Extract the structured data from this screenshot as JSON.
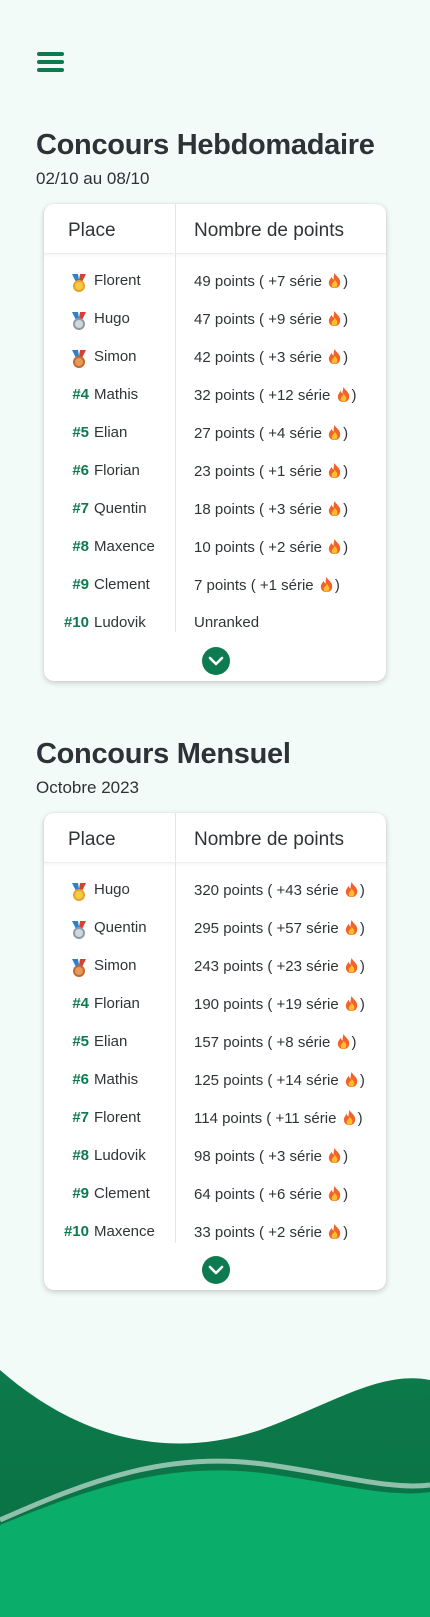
{
  "nav": {
    "menu_icon": "hamburger-menu-icon"
  },
  "colors": {
    "accent": "#0e7a4f",
    "background": "#f3fbf8",
    "wave_dark": "#0a7a48",
    "wave_light": "#0aa868"
  },
  "weekly": {
    "title": "Concours Hebdomadaire",
    "subtitle": "02/10 au 08/10",
    "header_place": "Place",
    "header_points": "Nombre de points",
    "rows": [
      {
        "rank": "",
        "medal": "gold",
        "name": "Florent",
        "points": "49 points ( +7 série",
        "suffix": ")",
        "fire": true
      },
      {
        "rank": "",
        "medal": "silver",
        "name": "Hugo",
        "points": "47 points ( +9 série",
        "suffix": ")",
        "fire": true
      },
      {
        "rank": "",
        "medal": "bronze",
        "name": "Simon",
        "points": "42 points ( +3 série",
        "suffix": ")",
        "fire": true
      },
      {
        "rank": "#4",
        "name": "Mathis",
        "points": "32 points ( +12 série",
        "suffix": ")",
        "fire": true
      },
      {
        "rank": "#5",
        "name": "Elian",
        "points": "27 points ( +4 série",
        "suffix": ")",
        "fire": true
      },
      {
        "rank": "#6",
        "name": "Florian",
        "points": "23 points ( +1 série",
        "suffix": ")",
        "fire": true
      },
      {
        "rank": "#7",
        "name": "Quentin",
        "points": "18 points ( +3 série",
        "suffix": ")",
        "fire": true
      },
      {
        "rank": "#8",
        "name": "Maxence",
        "points": "10 points ( +2 série",
        "suffix": ")",
        "fire": true
      },
      {
        "rank": "#9",
        "name": "Clement",
        "points": "7 points ( +1 série",
        "suffix": ")",
        "fire": true
      },
      {
        "rank": "#10",
        "name": "Ludovik",
        "points": "Unranked",
        "suffix": "",
        "fire": false
      }
    ],
    "expand_icon": "chevron-down-icon"
  },
  "monthly": {
    "title": "Concours Mensuel",
    "subtitle": "Octobre 2023",
    "header_place": "Place",
    "header_points": "Nombre de points",
    "rows": [
      {
        "rank": "",
        "medal": "gold",
        "name": "Hugo",
        "points": "320 points ( +43 série",
        "suffix": ")",
        "fire": true
      },
      {
        "rank": "",
        "medal": "silver",
        "name": "Quentin",
        "points": "295 points ( +57 série",
        "suffix": ")",
        "fire": true
      },
      {
        "rank": "",
        "medal": "bronze",
        "name": "Simon",
        "points": "243 points ( +23 série",
        "suffix": ")",
        "fire": true
      },
      {
        "rank": "#4",
        "name": "Florian",
        "points": "190 points ( +19 série",
        "suffix": ")",
        "fire": true
      },
      {
        "rank": "#5",
        "name": "Elian",
        "points": "157 points ( +8 série",
        "suffix": ")",
        "fire": true
      },
      {
        "rank": "#6",
        "name": "Mathis",
        "points": "125 points ( +14 série",
        "suffix": ")",
        "fire": true
      },
      {
        "rank": "#7",
        "name": "Florent",
        "points": "114 points ( +11 série",
        "suffix": ")",
        "fire": true
      },
      {
        "rank": "#8",
        "name": "Ludovik",
        "points": "98 points ( +3 série",
        "suffix": ")",
        "fire": true
      },
      {
        "rank": "#9",
        "name": "Clement",
        "points": "64 points ( +6 série",
        "suffix": ")",
        "fire": true
      },
      {
        "rank": "#10",
        "name": "Maxence",
        "points": "33 points ( +2 série",
        "suffix": ")",
        "fire": true
      }
    ],
    "expand_icon": "chevron-down-icon"
  }
}
